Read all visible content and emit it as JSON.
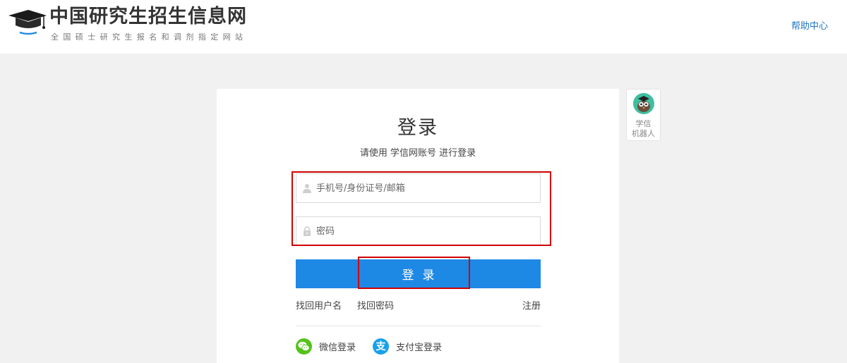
{
  "header": {
    "logo_title": "中国研究生招生信息网",
    "logo_subtitle": "全国硕士研究生报名和调剂指定网站",
    "help_link": "帮助中心"
  },
  "login": {
    "title": "登录",
    "subtitle": "请使用 学信网账号 进行登录",
    "username_placeholder": "手机号/身份证号/邮箱",
    "password_placeholder": "密码",
    "submit_label": "登录",
    "forgot_username": "找回用户名",
    "forgot_password": "找回密码",
    "register": "注册",
    "wechat_login": "微信登录",
    "alipay_login": "支付宝登录",
    "alipay_glyph": "支"
  },
  "robot": {
    "label_line1": "学信",
    "label_line2": "机器人"
  },
  "icons": {
    "logo": "graduation-cap-icon",
    "username": "user-icon",
    "password": "lock-icon",
    "wechat": "wechat-icon",
    "alipay": "alipay-icon",
    "robot": "robot-avatar-icon"
  },
  "colors": {
    "accent": "#1e88e5",
    "link": "#1f76c4",
    "highlight": "#d10000",
    "wechat": "#55c21b",
    "alipay": "#18a1e9"
  }
}
